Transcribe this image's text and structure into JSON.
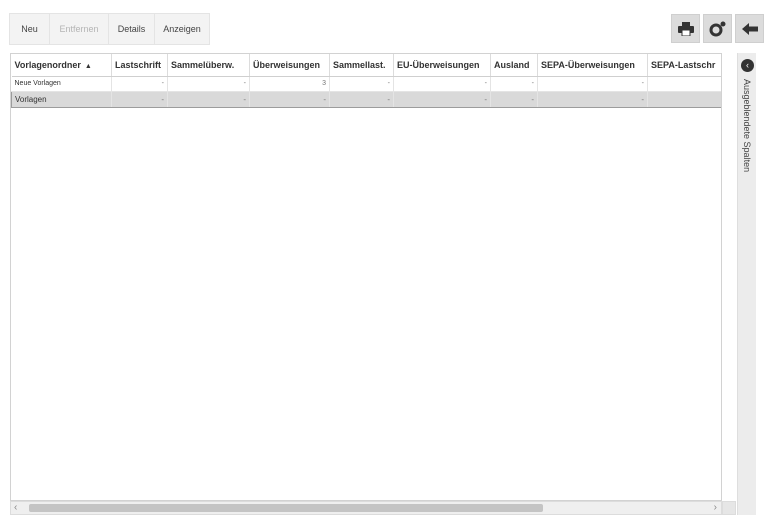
{
  "toolbar": {
    "buttons": [
      {
        "label": "Neu",
        "enabled": true
      },
      {
        "label": "Entfernen",
        "enabled": false
      },
      {
        "label": "Details",
        "enabled": true
      },
      {
        "label": "Anzeigen",
        "enabled": true
      }
    ],
    "icons": [
      "print-icon",
      "settings-icon",
      "back-arrow-icon"
    ]
  },
  "grid": {
    "columns": [
      "Vorlagenordner",
      "Lastschrift",
      "Sammelüberw.",
      "Überweisungen",
      "Sammellast.",
      "EU-Überweisungen",
      "Ausland",
      "SEPA-Überweisungen",
      "SEPA-Lastschr"
    ],
    "sort_indicator": "▲",
    "rows": [
      {
        "cells": [
          "Neue Vorlagen",
          "-",
          "-",
          "3",
          "-",
          "-",
          "-",
          "-",
          ""
        ],
        "selected": false
      },
      {
        "cells": [
          "Vorlagen",
          "-",
          "-",
          "-",
          "-",
          "-",
          "-",
          "-",
          ""
        ],
        "selected": true
      }
    ]
  },
  "side_panel": {
    "label": "Ausgeblendete Spalten",
    "icon": "expand-panel-icon"
  },
  "scrollbar": {
    "left_arrow": "‹",
    "right_arrow": "›"
  }
}
